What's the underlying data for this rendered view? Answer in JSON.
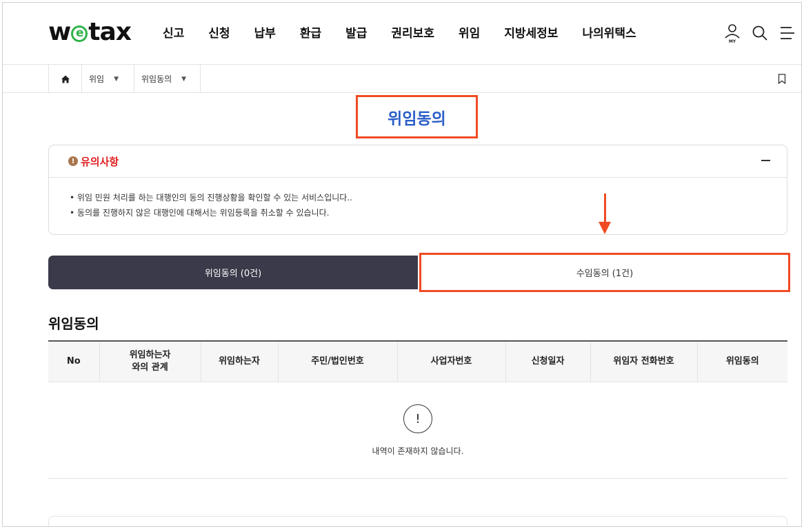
{
  "header": {
    "logo": {
      "pre": "w",
      "mid": "e",
      "post": "tax"
    },
    "nav": [
      "신고",
      "신청",
      "납부",
      "환급",
      "발급",
      "권리보호",
      "위임",
      "지방세정보",
      "나의위택스"
    ],
    "icons": [
      "my-page-icon",
      "search-icon",
      "menu-icon"
    ],
    "my_label": "MY"
  },
  "breadcrumb": {
    "home_icon": "home-icon",
    "items": [
      "위임",
      "위임동의"
    ],
    "bookmark_icon": "bookmark-icon"
  },
  "page_title": "위임동의",
  "notice": {
    "title": "유의사항",
    "icon_text": "!",
    "items": [
      "위임 민원 처리를 하는 대행인의 동의 진행상황을 확인할 수 있는 서비스입니다..",
      "동의를 진행하지 않은 대행인에 대해서는 위임등록을 취소할 수 있습니다."
    ]
  },
  "tabs": [
    {
      "label": "위임동의 (0건)",
      "active": true
    },
    {
      "label": "수임동의 (1건)",
      "active": false
    }
  ],
  "section_title": "위임동의",
  "table": {
    "columns": [
      "No",
      "위임하는자\n와의 관계",
      "위임하는자",
      "주민/법인번호",
      "사업자번호",
      "신청일자",
      "위임자 전화번호",
      "위임동의"
    ]
  },
  "empty": {
    "icon_text": "!",
    "message": "내역이 존재하지 않습니다."
  },
  "colors": {
    "accent_red": "#f04a23",
    "title_blue": "#2b5fc8",
    "tab_dark": "#3a3a4a",
    "logo_green": "#2fb34a"
  }
}
